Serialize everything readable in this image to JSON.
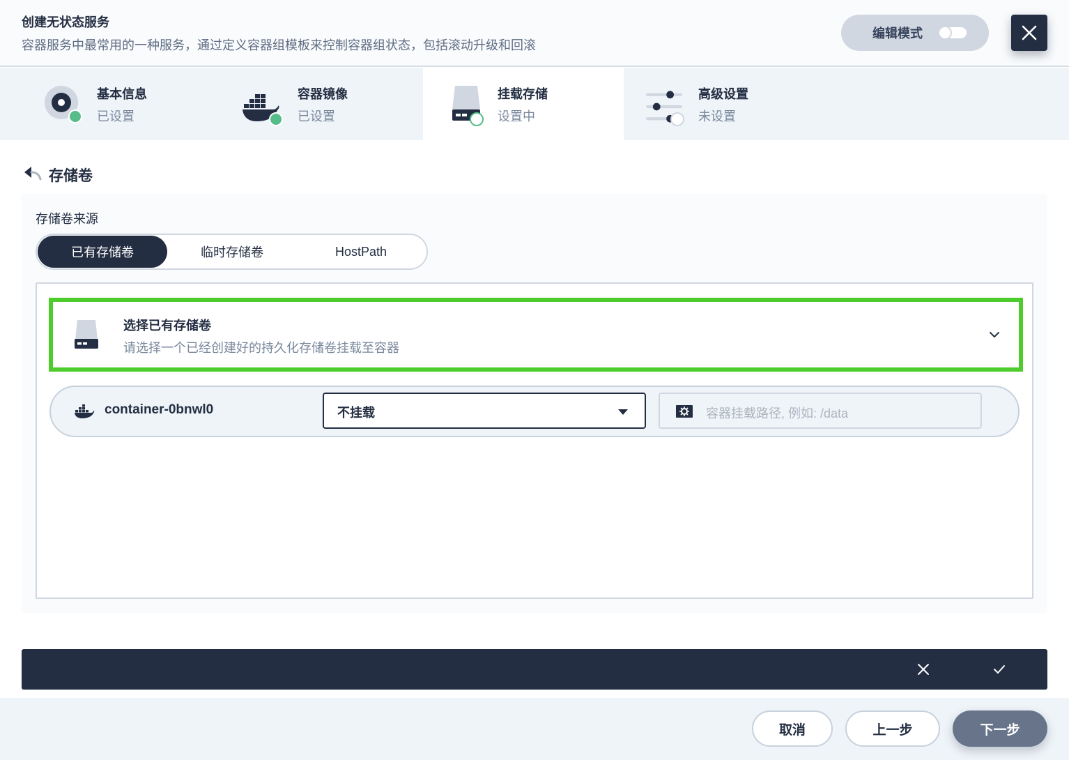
{
  "header": {
    "title": "创建无状态服务",
    "description": "容器服务中最常用的一种服务，通过定义容器组模板来控制容器组状态，包括滚动升级和回滚",
    "edit_mode_label": "编辑模式"
  },
  "steps": [
    {
      "title": "基本信息",
      "status": "已设置",
      "icon": "basic-info-icon"
    },
    {
      "title": "容器镜像",
      "status": "已设置",
      "icon": "docker-icon"
    },
    {
      "title": "挂载存储",
      "status": "设置中",
      "icon": "storage-icon"
    },
    {
      "title": "高级设置",
      "status": "未设置",
      "icon": "settings-sliders-icon"
    }
  ],
  "section": {
    "title": "存储卷"
  },
  "volume_source": {
    "label": "存储卷来源",
    "options": [
      "已有存储卷",
      "临时存储卷",
      "HostPath"
    ],
    "selected": "已有存储卷"
  },
  "select_volume": {
    "title": "选择已有存储卷",
    "description": "请选择一个已经创建好的持久化存储卷挂载至容器"
  },
  "mount": {
    "container_name": "container-0bnwl0",
    "mode_value": "不挂载",
    "path_placeholder": "容器挂载路径, 例如: /data"
  },
  "footer": {
    "cancel": "取消",
    "prev": "上一步",
    "next": "下一步"
  },
  "colors": {
    "dark": "#242e42",
    "success": "#55bc8a",
    "highlight": "#4ccd2b"
  }
}
